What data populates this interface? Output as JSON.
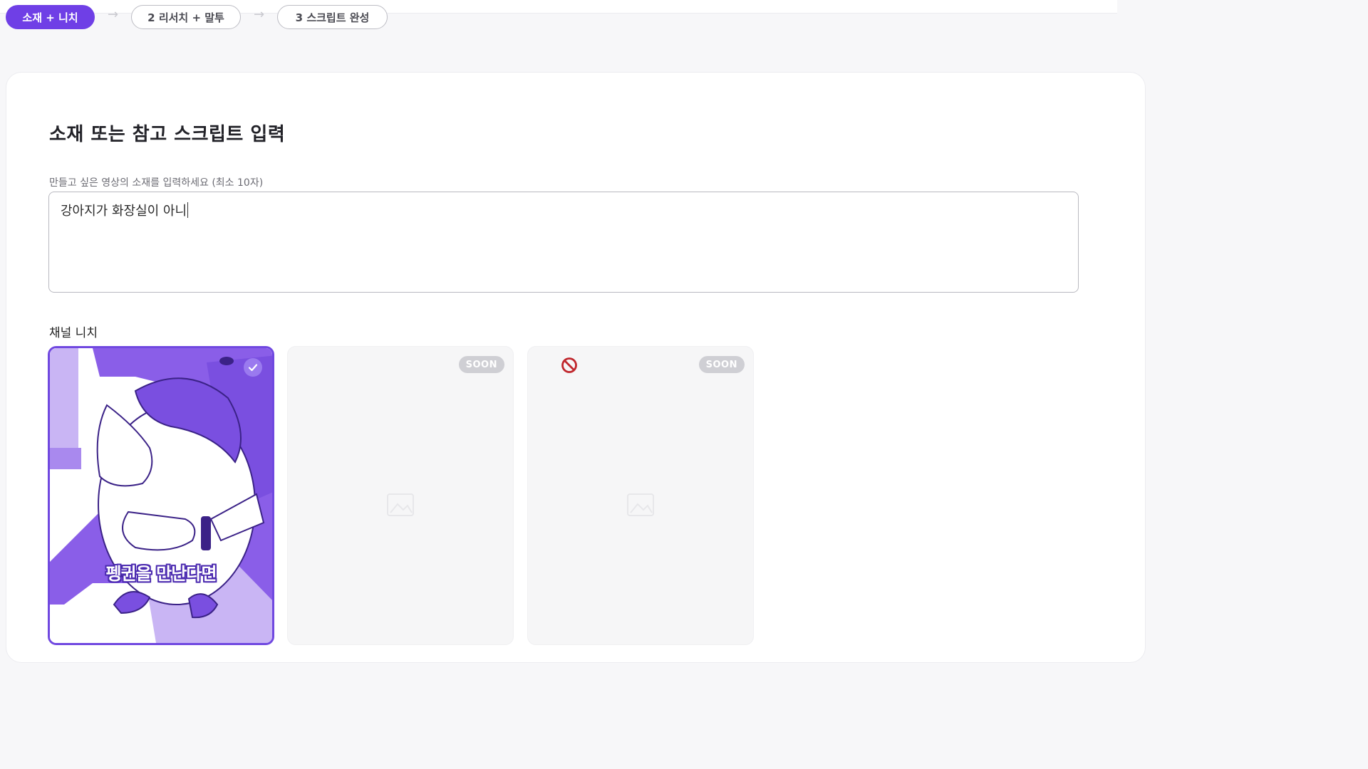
{
  "steps": [
    {
      "label": "소재 + 니치",
      "active": true
    },
    {
      "label": "2 리서치 + 말투",
      "active": false
    },
    {
      "label": "3 스크립트 완성",
      "active": false
    }
  ],
  "step_arrow": "→",
  "page_title": "소재 또는 참고 스크립트 입력",
  "topic_field": {
    "label": "만들고 싶은 영상의 소재를 입력하세요 (최소 10자)",
    "value": "강아지가 화장실이 아니"
  },
  "niche_section_label": "채널 니치",
  "niche_cards": [
    {
      "caption": "펭귄을 만난다면",
      "selected": true,
      "icon": "check-icon"
    },
    {
      "badge": "SOON",
      "icon": "image-placeholder-icon"
    },
    {
      "badge": "SOON",
      "icon": "no-entry-icon"
    }
  ],
  "colors": {
    "accent": "#6f3fe6",
    "thumb_purple": "#7a4fe0",
    "soon_badge": "#cfcfd4",
    "blocked_red": "#c0272d"
  }
}
